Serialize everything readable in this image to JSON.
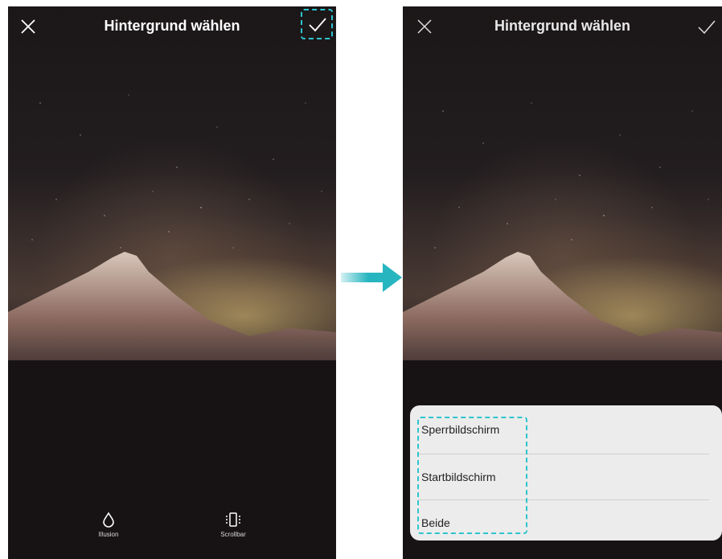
{
  "left_screen": {
    "title": "Hintergrund wählen",
    "tools": [
      {
        "label": "Illusion",
        "icon": "droplet-icon"
      },
      {
        "label": "Scrollbar",
        "icon": "scroll-phone-icon"
      }
    ]
  },
  "right_screen": {
    "title": "Hintergrund wählen",
    "options": [
      "Sperrbildschirm",
      "Startbildschirm",
      "Beide"
    ]
  },
  "colors": {
    "highlight": "#2ec4cf",
    "arrow": "#27b6c0"
  }
}
